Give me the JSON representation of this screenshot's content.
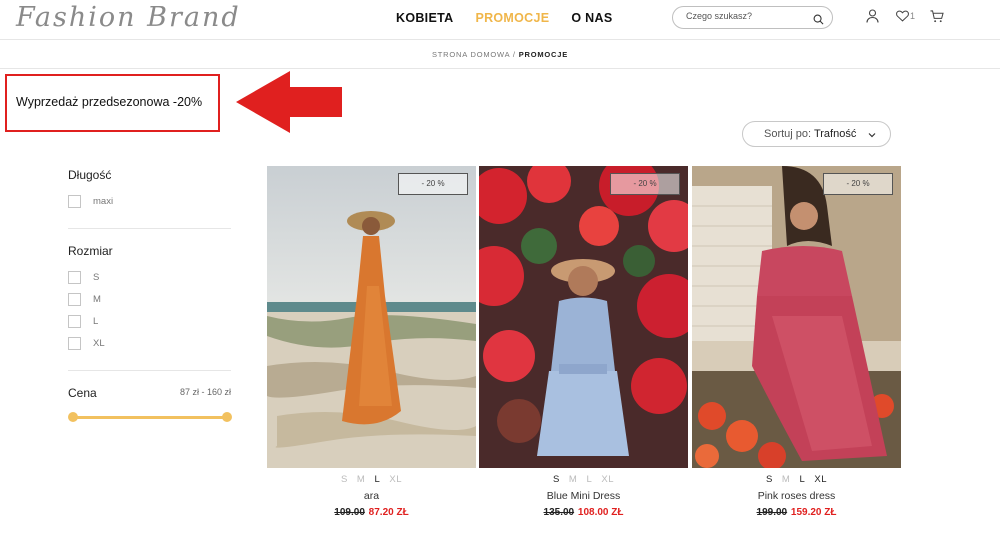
{
  "header": {
    "logo": "Fashion Brand",
    "nav": [
      {
        "label": "KOBIETA",
        "active": false
      },
      {
        "label": "PROMOCJE",
        "active": true
      },
      {
        "label": "O NAS",
        "active": false
      }
    ],
    "search_placeholder": "Czego szukasz?",
    "wishlist_count": "1"
  },
  "breadcrumb": {
    "home": "STRONA DOMOWA",
    "separator": "/",
    "current": "PROMOCJE"
  },
  "promo_title": "Wyprzedaż przedsezonowa -20%",
  "sort": {
    "label": "Sortuj po:",
    "value": "Trafność"
  },
  "filters": {
    "length": {
      "title": "Długość",
      "options": [
        "maxi"
      ]
    },
    "size": {
      "title": "Rozmiar",
      "options": [
        "S",
        "M",
        "L",
        "XL"
      ]
    },
    "price": {
      "title": "Cena",
      "range": "87 zł - 160 zł"
    }
  },
  "products": [
    {
      "name": "ara",
      "badge": "- 20 %",
      "sizes": [
        "S",
        "M",
        "L",
        "XL"
      ],
      "available": [
        "L"
      ],
      "old_price": "109.00",
      "new_price": "87.20 ZŁ"
    },
    {
      "name": "Blue Mini Dress",
      "badge": "- 20 %",
      "sizes": [
        "S",
        "M",
        "L",
        "XL"
      ],
      "available": [
        "S"
      ],
      "old_price": "135.00",
      "new_price": "108.00 ZŁ"
    },
    {
      "name": "Pink roses dress",
      "badge": "- 20 %",
      "sizes": [
        "S",
        "M",
        "L",
        "XL"
      ],
      "available": [
        "S",
        "L",
        "XL"
      ],
      "old_price": "199.00",
      "new_price": "159.20 ZŁ"
    }
  ],
  "colors": {
    "accent": "#f0b64a",
    "sale_red": "#e0201f",
    "slider": "#f2c15f"
  }
}
